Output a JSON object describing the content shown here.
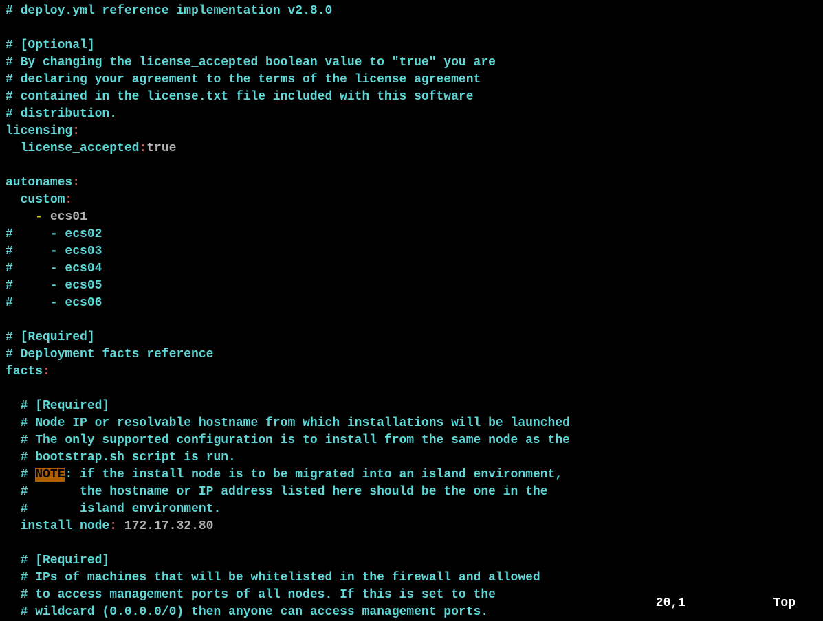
{
  "lines": [
    {
      "type": "comment",
      "text": "# deploy.yml reference implementation v2.8.0"
    },
    {
      "type": "blank",
      "text": ""
    },
    {
      "type": "comment",
      "text": "# [Optional]"
    },
    {
      "type": "comment",
      "text": "# By changing the license_accepted boolean value to \"true\" you are"
    },
    {
      "type": "comment",
      "text": "# declaring your agreement to the terms of the license agreement"
    },
    {
      "type": "comment",
      "text": "# contained in the license.txt file included with this software"
    },
    {
      "type": "comment",
      "text": "# distribution."
    },
    {
      "type": "key",
      "key": "licensing",
      "colon": ":"
    },
    {
      "type": "keyvalue",
      "indent": "  ",
      "key": "license_accepted",
      "colon": ":",
      "value": "true"
    },
    {
      "type": "blank",
      "text": ""
    },
    {
      "type": "key",
      "key": "autonames",
      "colon": ":"
    },
    {
      "type": "key",
      "indent": "  ",
      "key": "custom",
      "colon": ":"
    },
    {
      "type": "listitem",
      "indent": "    ",
      "dash": "- ",
      "value": "ecs01"
    },
    {
      "type": "comment",
      "text": "#     - ecs02"
    },
    {
      "type": "comment",
      "text": "#     - ecs03"
    },
    {
      "type": "comment",
      "text": "#     - ecs04"
    },
    {
      "type": "comment",
      "text": "#     - ecs05"
    },
    {
      "type": "comment",
      "text": "#     - ecs06"
    },
    {
      "type": "blank",
      "text": ""
    },
    {
      "type": "comment",
      "text": "# [Required]"
    },
    {
      "type": "comment",
      "text": "# Deployment facts reference"
    },
    {
      "type": "key",
      "key": "facts",
      "colon": ":"
    },
    {
      "type": "blank",
      "text": ""
    },
    {
      "type": "comment",
      "text": "  # [Required]"
    },
    {
      "type": "comment",
      "text": "  # Node IP or resolvable hostname from which installations will be launched"
    },
    {
      "type": "comment",
      "text": "  # The only supported configuration is to install from the same node as the"
    },
    {
      "type": "comment",
      "text": "  # bootstrap.sh script is run."
    },
    {
      "type": "note",
      "prefix": "  # ",
      "note": "NOTE",
      "rest": ": if the install node is to be migrated into an island environment,"
    },
    {
      "type": "comment",
      "text": "  #       the hostname or IP address listed here should be the one in the"
    },
    {
      "type": "comment",
      "text": "  #       island environment."
    },
    {
      "type": "keyvalue",
      "indent": "  ",
      "key": "install_node",
      "colon": ": ",
      "value": "172.17.32.80"
    },
    {
      "type": "blank",
      "text": ""
    },
    {
      "type": "comment",
      "text": "  # [Required]"
    },
    {
      "type": "comment",
      "text": "  # IPs of machines that will be whitelisted in the firewall and allowed"
    },
    {
      "type": "comment",
      "text": "  # to access management ports of all nodes. If this is set to the"
    },
    {
      "type": "comment",
      "text": "  # wildcard (0.0.0.0/0) then anyone can access management ports."
    }
  ],
  "status": {
    "position": "20,1",
    "percent": "Top"
  }
}
